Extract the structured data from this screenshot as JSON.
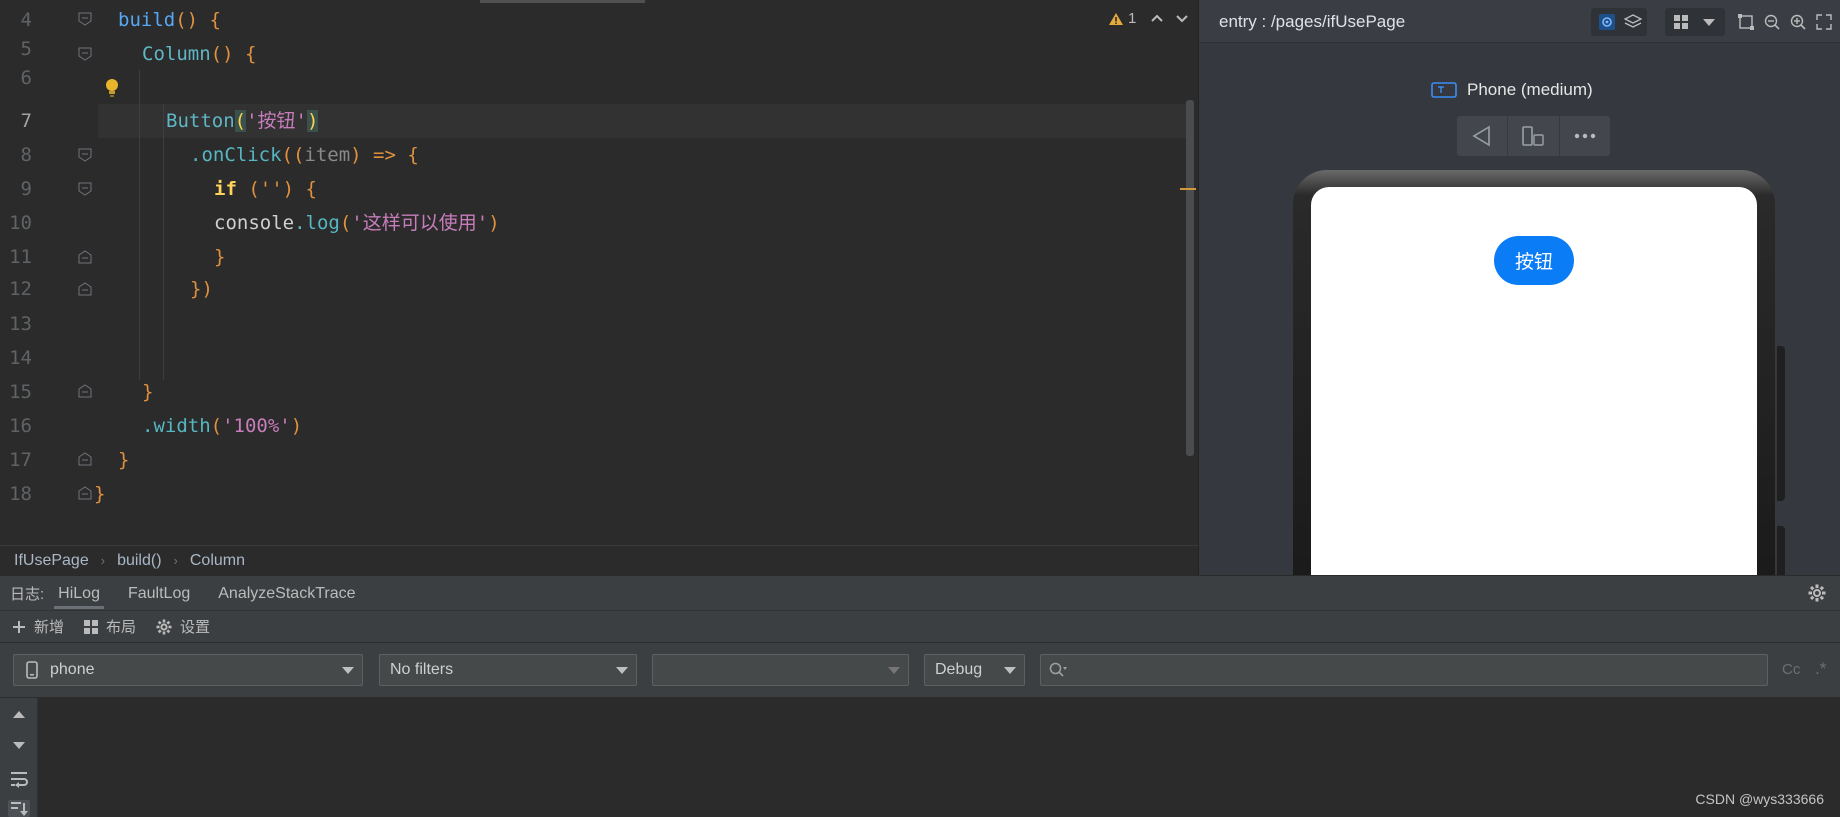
{
  "editor": {
    "lines": [
      {
        "num": "4"
      },
      {
        "num": "5"
      },
      {
        "num": "6"
      },
      {
        "num": "7"
      },
      {
        "num": "8"
      },
      {
        "num": "9"
      },
      {
        "num": "10"
      },
      {
        "num": "11"
      },
      {
        "num": "12"
      },
      {
        "num": "13"
      },
      {
        "num": "14"
      },
      {
        "num": "15"
      },
      {
        "num": "16"
      },
      {
        "num": "17"
      },
      {
        "num": "18"
      }
    ],
    "code": {
      "l4": {
        "fn": "build",
        "rest": "() {"
      },
      "l5": {
        "fn": "Column",
        "rest": "() {"
      },
      "l7": {
        "fn": "Button",
        "open": "(",
        "str": "'按钮'",
        "close": ")"
      },
      "l8": {
        "method": ".onClick",
        "open": "((",
        "param": "item",
        "rest": ") => {"
      },
      "l9": {
        "kw": "if",
        "rest": " ('') {"
      },
      "l10": {
        "obj": "console",
        "method": ".log",
        "open": "(",
        "str": "'这样可以使用'",
        "close": ")"
      },
      "l11": "}",
      "l12": "})",
      "l15": "}",
      "l16": {
        "method": ".width",
        "open": "(",
        "str": "'100%'",
        "close": ")"
      },
      "l17": "}",
      "l18": "}"
    },
    "warning_count": "1"
  },
  "breadcrumb": [
    "IfUsePage",
    "build()",
    "Column"
  ],
  "preview": {
    "path": "entry : /pages/ifUsePage",
    "device": "Phone (medium)",
    "button_label": "按钮"
  },
  "log": {
    "label": "日志:",
    "tabs": [
      "HiLog",
      "FaultLog",
      "AnalyzeStackTrace"
    ],
    "toolbar": {
      "add": "新增",
      "layout": "布局",
      "settings": "设置"
    },
    "device_select": "phone",
    "filter_select": "No filters",
    "process_select": "",
    "level_select": "Debug",
    "search_placeholder": "",
    "case_option": "Cc",
    "regex_option": ".*"
  },
  "watermark": "CSDN @wys333666",
  "colors": {
    "editor_bg": "#2b2b2b",
    "panel_bg": "#3c3f41",
    "accent_blue": "#0a7cf5",
    "warning": "#e3a93a"
  }
}
